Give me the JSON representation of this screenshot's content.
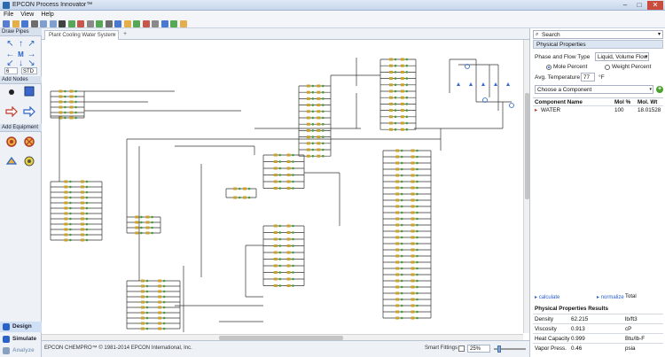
{
  "window": {
    "title": "EPCON Process Innovator™",
    "controls": [
      "–",
      "□",
      "✕"
    ]
  },
  "menu": [
    "File",
    "View",
    "Help"
  ],
  "toolbar_icons": [
    "new-file-icon",
    "open-folder-icon",
    "save-icon",
    "print-icon",
    "copy-icon",
    "paste-icon",
    "text-tool-icon",
    "refresh-icon",
    "database-icon",
    "wrench-icon",
    "flask-icon",
    "calculator-icon",
    "valve-icon",
    "pump-icon",
    "tank-icon",
    "exchanger-icon",
    "settings-icon",
    "chart-icon",
    "report-icon",
    "help-icon"
  ],
  "left_panel": {
    "draw_pipes": "Draw Pipes",
    "center_label": "M",
    "pipe_size": "6",
    "pipe_schedule": "STD",
    "add_nodes": "Add Nodes",
    "add_equipment": "Add Equipment",
    "modes": [
      {
        "label": "Design",
        "color": "#2a62c9"
      },
      {
        "label": "Simulate",
        "color": "#2a62c9"
      },
      {
        "label": "Analyze",
        "color": "#8aa0c0"
      }
    ]
  },
  "tabs": {
    "document": "Plant Cooling Water System",
    "close": "×",
    "add": "+"
  },
  "status": {
    "copyright": "EPCON CHEMPRO™ © 1981-2014 EPCON International, Inc.",
    "smart_fittings": "Smart Fittings",
    "zoom": "25%"
  },
  "right_panel": {
    "search": "Search",
    "header": "Physical Properties",
    "phase_label": "Phase and Flow Type",
    "phase_value": "Liquid, Volume Flow",
    "mole_percent": "Mole Percent",
    "weight_percent": "Weight Percent",
    "avg_temp_label": "Avg. Temperature",
    "avg_temp_value": "77",
    "avg_temp_unit": "°F",
    "choose_component": "Choose a Component",
    "table_headers": {
      "name": "Component Name",
      "mol": "Mol %",
      "wt": "Mol. Wt"
    },
    "components": [
      {
        "name": "WATER",
        "mol": "100",
        "wt": "18.01528"
      }
    ],
    "calculate": "calculate",
    "normalize": "normalize",
    "total": "Total",
    "results_title": "Physical Properties Results",
    "results": [
      {
        "prop": "Density",
        "value": "62.215",
        "unit": "lb/ft3"
      },
      {
        "prop": "Viscosity",
        "value": "0.913",
        "unit": "cP"
      },
      {
        "prop": "Heat Capacity",
        "value": "0.999",
        "unit": "Btu/lb-F"
      },
      {
        "prop": "Vapor Press.",
        "value": "0.46",
        "unit": "psia"
      }
    ]
  },
  "colors": {
    "accent": "#2a62c9",
    "pipe": "#333333",
    "valve": "#c9a227",
    "node": "#4a9a3a"
  }
}
